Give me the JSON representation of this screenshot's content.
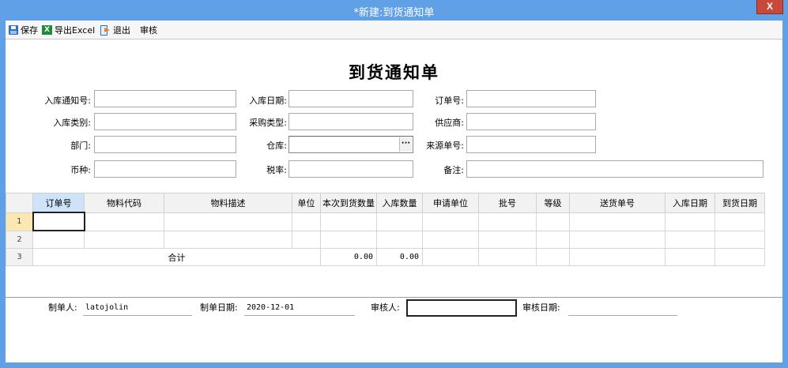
{
  "window": {
    "title": "*新建:到货通知单",
    "close_label": "X"
  },
  "toolbar": {
    "save_label": "保存",
    "export_label": "导出Excel",
    "excel_glyph": "X",
    "exit_label": "退出",
    "audit_label": "审核"
  },
  "document": {
    "title": "到货通知单"
  },
  "form": {
    "inbound_notice_no": {
      "label": "入库通知号:",
      "value": ""
    },
    "inbound_date": {
      "label": "入库日期:",
      "value": ""
    },
    "order_no": {
      "label": "订单号:",
      "value": ""
    },
    "inbound_type": {
      "label": "入库类别:",
      "value": ""
    },
    "purchase_type": {
      "label": "采购类型:",
      "value": ""
    },
    "supplier": {
      "label": "供应商:",
      "value": ""
    },
    "department": {
      "label": "部门:",
      "value": ""
    },
    "warehouse": {
      "label": "仓库:",
      "value": "",
      "ellipsis": "···"
    },
    "source_no": {
      "label": "来源单号:",
      "value": ""
    },
    "currency": {
      "label": "币种:",
      "value": ""
    },
    "tax_rate": {
      "label": "税率:",
      "value": ""
    },
    "remark": {
      "label": "备注:",
      "value": ""
    }
  },
  "grid": {
    "columns": [
      "订单号",
      "物料代码",
      "物料描述",
      "单位",
      "本次到货数量",
      "入库数量",
      "申请单位",
      "批号",
      "等级",
      "送货单号",
      "入库日期",
      "到货日期"
    ],
    "rows": [
      {
        "num": "1",
        "cells": [
          "",
          "",
          "",
          "",
          "",
          "",
          "",
          "",
          "",
          "",
          "",
          ""
        ]
      },
      {
        "num": "2",
        "cells": [
          "",
          "",
          "",
          "",
          "",
          "",
          "",
          "",
          "",
          "",
          "",
          ""
        ]
      }
    ],
    "total_row": {
      "num": "3",
      "label": "合计",
      "arrival_qty": "0.00",
      "inbound_qty": "0.00"
    }
  },
  "footer": {
    "creator_label": "制单人:",
    "creator": "latojolin",
    "create_date_label": "制单日期:",
    "create_date": "2020-12-01",
    "auditor_label": "审核人:",
    "auditor": "",
    "audit_date_label": "审核日期:",
    "audit_date": ""
  },
  "colors": {
    "titlebar": "#5fa0e6",
    "close_button": "#c9483c",
    "selected_header": "#cfe3f8",
    "selected_row_number": "#fbe7b0"
  }
}
